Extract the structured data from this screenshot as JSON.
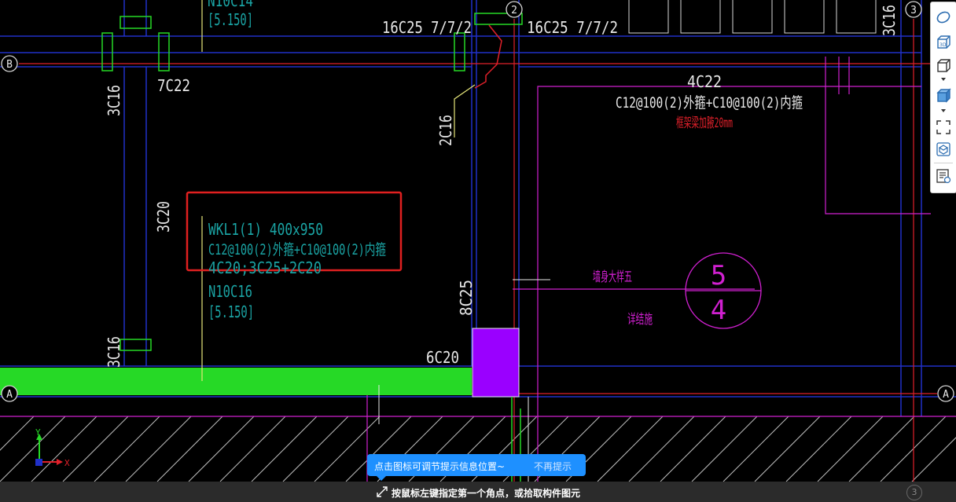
{
  "drawing": {
    "axes": {
      "x_label": "X",
      "y_label": "Y",
      "grid_2": "2",
      "grid_3": "3",
      "grid_b": "B",
      "grid_a_left": "A",
      "grid_a_right": "A"
    },
    "labels": {
      "top_stub_1": "N10C14",
      "top_stub_2": "[5.150]",
      "rebar_top_left": "16C25 7/7/2",
      "rebar_top_right": "16C25 7/7/2",
      "col_3c16_top_right": "3C16",
      "col_3c16_left": "3C16",
      "col_7c22": "7C22",
      "col_2c16": "2C16",
      "col_3c20": "3C20",
      "col_3c16_bottom": "3C16",
      "col_8c25": "8C25",
      "col_6c20": "6C20",
      "beam_4c22": "4C22",
      "beam_stirrup_right": "C12@100(2)外箍+C10@100(2)内箍",
      "note_red": "框架梁加腋20mm",
      "beam_name": "WKL1(1) 400x950",
      "beam_stirrup": "C12@100(2)外箍+C10@100(2)内箍",
      "beam_main": "4C20;3C25+2C20",
      "beam_side": "N10C16",
      "beam_level": "[5.150]",
      "wall_detail": "墙身大样五",
      "see_structure": "详结施",
      "detail_num": "5",
      "detail_sheet": "4"
    }
  },
  "toolbar": {
    "items": [
      "orbit-icon",
      "3d-view-icon",
      "cube-view-icon",
      "shaded-cube-icon",
      "fullscreen-icon",
      "component-view-icon",
      "property-list-icon"
    ]
  },
  "tip": {
    "message": "点击图标可调节提示信息位置~",
    "dismiss": "不再提示"
  },
  "status": {
    "prompt": "按鼠标左键指定第一个角点，或拾取构件图元",
    "axis_marker": "3"
  },
  "colors": {
    "background": "#000000",
    "grid_red": "#e0202a",
    "beam_blue": "#2030c8",
    "text_white": "#e8e8e8",
    "text_cyan": "#1aa3a3",
    "magenta": "#d020d0",
    "green_beam": "#26d926",
    "purple_column": "#9a00ff",
    "selection_red": "#e02020",
    "tip_blue": "#1e90ff"
  }
}
